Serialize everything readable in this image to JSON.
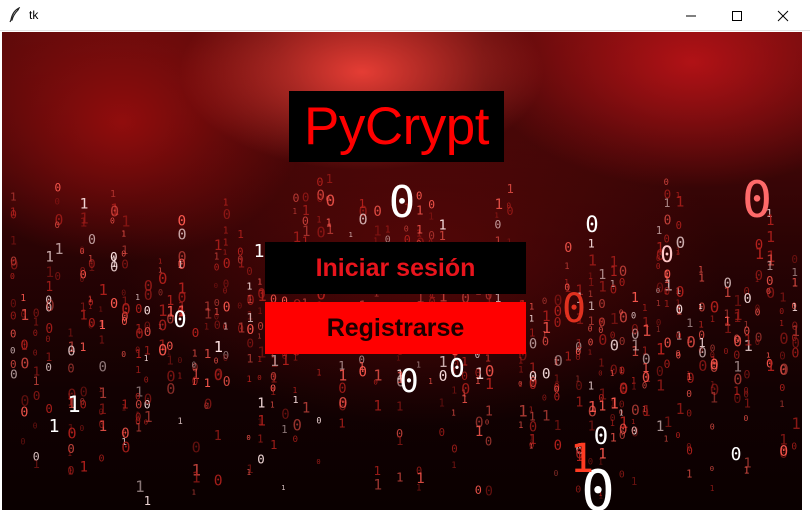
{
  "window": {
    "title": "tk",
    "app_icon": "feather-icon",
    "controls": [
      "minimize-icon",
      "maximize-icon",
      "close-icon"
    ]
  },
  "app": {
    "logo_text": "PyCrypt",
    "login_button": "Iniciar sesión",
    "register_button": "Registrarse"
  },
  "background": {
    "theme": "red binary code rain",
    "digits": [
      "0",
      "1"
    ]
  },
  "colors": {
    "logo_text": "#ff0000",
    "logo_bg": "#000000",
    "login_bg": "#000000",
    "login_text": "#e8141c",
    "register_bg": "#ff0000",
    "register_text": "#1a0000"
  }
}
